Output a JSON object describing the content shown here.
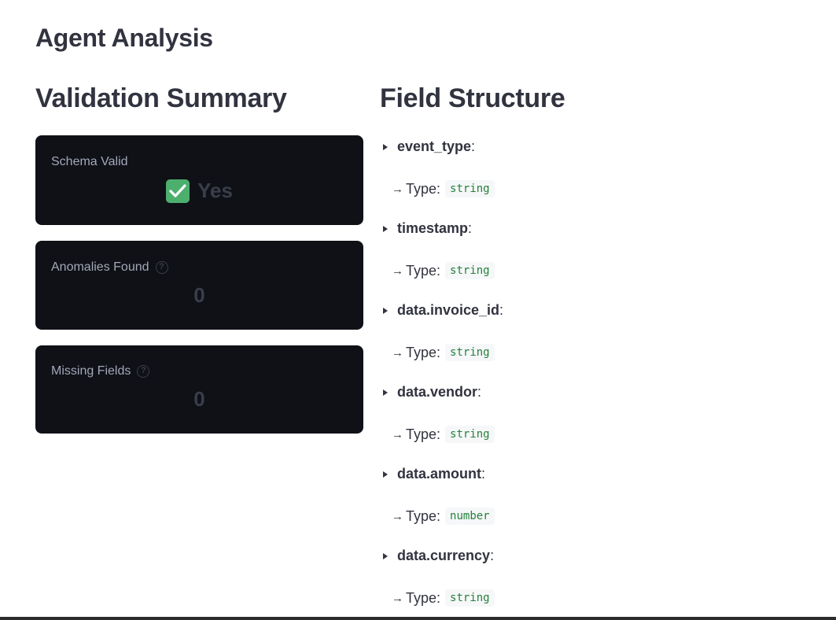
{
  "page": {
    "title": "Agent Analysis"
  },
  "validation": {
    "title": "Validation Summary",
    "metrics": [
      {
        "label": "Schema Valid",
        "value": "Yes",
        "icon": "check-icon",
        "has_help": false
      },
      {
        "label": "Anomalies Found",
        "value": "0",
        "icon": "",
        "has_help": true
      },
      {
        "label": "Missing Fields",
        "value": "0",
        "icon": "",
        "has_help": true
      }
    ]
  },
  "structure": {
    "title": "Field Structure",
    "type_label": "Type:",
    "arrow": "→",
    "fields": [
      {
        "name": "event_type",
        "type": "string"
      },
      {
        "name": "timestamp",
        "type": "string"
      },
      {
        "name": "data.invoice_id",
        "type": "string"
      },
      {
        "name": "data.vendor",
        "type": "string"
      },
      {
        "name": "data.amount",
        "type": "number"
      },
      {
        "name": "data.currency",
        "type": "string"
      }
    ]
  },
  "colors": {
    "card_bg": "#0f1117",
    "code_green": "#23813b",
    "check_green": "#4caf6e"
  }
}
